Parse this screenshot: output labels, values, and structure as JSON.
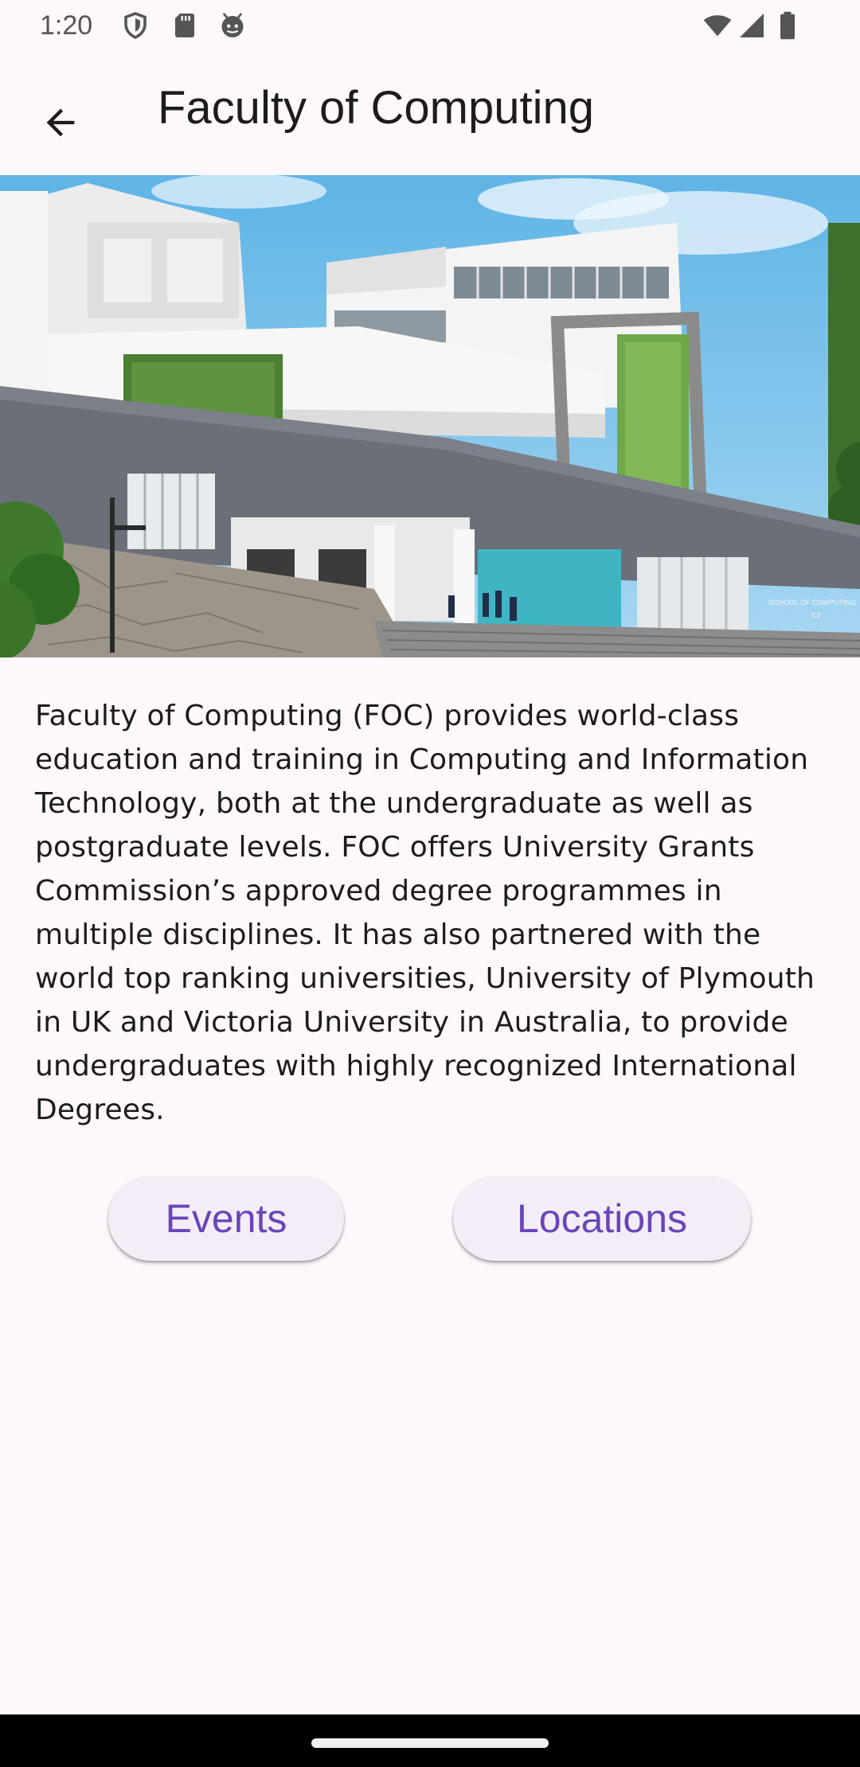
{
  "status_bar": {
    "time": "1:20",
    "left_icons": [
      "shield-icon",
      "sd-card-icon",
      "android-icon"
    ],
    "right_icons": [
      "wifi-icon",
      "cellular-signal-icon",
      "battery-icon"
    ]
  },
  "app_bar": {
    "back_icon": "arrow-back-icon",
    "title": "Faculty of Computing"
  },
  "hero_image": {
    "subject": "building-photo",
    "sign_line1": "SCHOOL OF COMPUTING",
    "sign_line2": "C2"
  },
  "content": {
    "description": "Faculty of Computing (FOC) provides world-class education and training in Computing and Information Technology, both at the undergraduate as well as postgraduate levels. FOC offers University Grants Commission’s approved degree programmes in multiple disciplines. It has also partnered with the world top ranking universities, University of Plymouth in UK and Victoria University in Australia, to provide undergraduates with highly recognized International Degrees."
  },
  "actions": {
    "events_label": "Events",
    "locations_label": "Locations"
  },
  "colors": {
    "background": "#fef7fc",
    "button_bg": "#f3edf7",
    "button_text": "#6a45b8",
    "title_text": "#1d1b20"
  }
}
